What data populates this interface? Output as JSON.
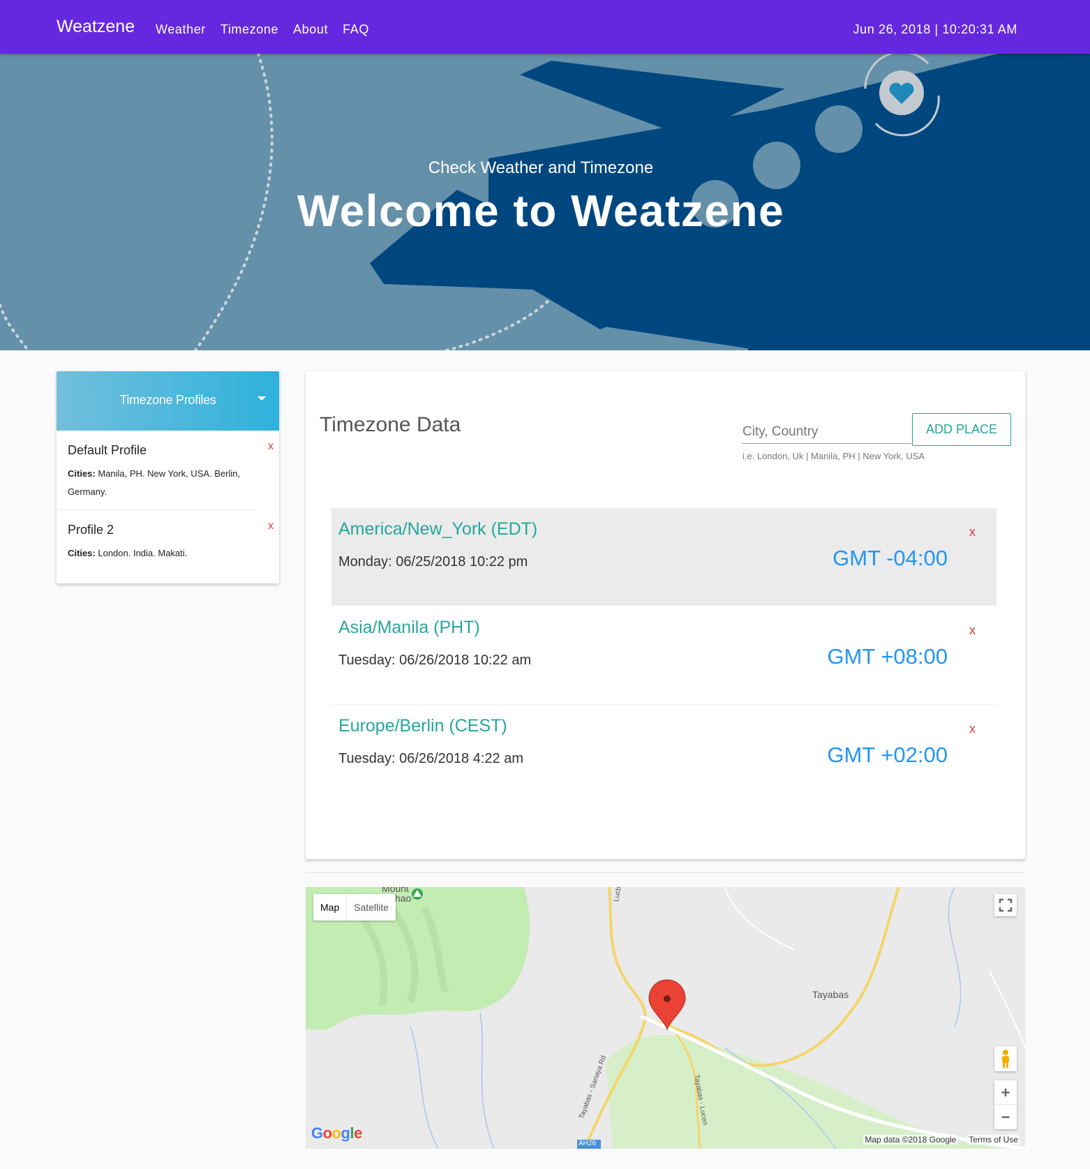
{
  "navbar": {
    "brand": "Weatzene",
    "links": [
      "Weather",
      "Timezone",
      "About",
      "FAQ"
    ],
    "clock": "Jun 26, 2018 | 10:20:31 AM"
  },
  "hero": {
    "subtitle": "Check Weather and Timezone",
    "title": "Welcome to Weatzene"
  },
  "sidebar": {
    "title": "Timezone Profiles",
    "profiles": [
      {
        "name": "Default Profile",
        "cities_label": "Cities:",
        "cities": "Manila, PH. New York, USA. Berlin, Germany.",
        "delete": "x"
      },
      {
        "name": "Profile 2",
        "cities_label": "Cities:",
        "cities": "London. India. Makati.",
        "delete": "x"
      }
    ]
  },
  "timezone": {
    "title": "Timezone Data",
    "input_placeholder": "City, Country",
    "hint": "i.e. London, Uk | Manila, PH | New York, USA",
    "add_button": "ADD PLACE",
    "rows": [
      {
        "name": "America/New_York (EDT)",
        "time": "Monday: 06/25/2018  10:22 pm",
        "gmt": "GMT -04:00",
        "delete": "x",
        "highlighted": true
      },
      {
        "name": "Asia/Manila (PHT)",
        "time": "Tuesday: 06/26/2018  10:22 am",
        "gmt": "GMT +08:00",
        "delete": "x",
        "highlighted": false
      },
      {
        "name": "Europe/Berlin (CEST)",
        "time": "Tuesday: 06/26/2018  4:22 am",
        "gmt": "GMT +02:00",
        "delete": "x",
        "highlighted": false
      }
    ]
  },
  "map": {
    "type_map": "Map",
    "type_satellite": "Satellite",
    "label_tayabas": "Tayabas",
    "label_mount": "Mount",
    "label_hao": "hao",
    "label_road1": "Lucban - Tayaba",
    "label_road2": "Tayabas - Sariaya Rd",
    "label_road3": "Tayabas - Lucen",
    "label_ah26": "AH26",
    "zoom_in": "+",
    "zoom_out": "−",
    "google": "Google",
    "attribution": "Map data ©2018 Google",
    "terms": "Terms of Use"
  },
  "colors": {
    "navbar": "#6528df",
    "hero_bg": "#6590aa",
    "plane": "#00477f",
    "accent_teal": "#26a69a",
    "accent_blue": "#2196f3",
    "delete_red": "#e53935"
  },
  "icons": [
    "caret-down-icon",
    "fullscreen-icon",
    "pegman-icon",
    "map-pin-icon",
    "heart-icon",
    "refresh-icon",
    "park-icon"
  ]
}
